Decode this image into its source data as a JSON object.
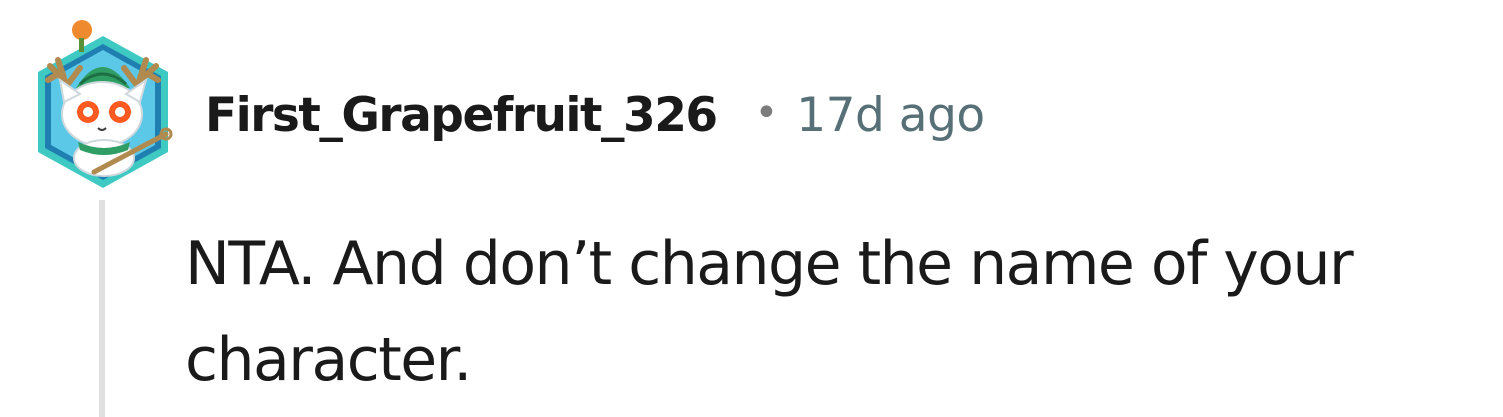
{
  "comment": {
    "author": "First_Grapefruit_326",
    "separator": "•",
    "timestamp": "17d ago",
    "body": "NTA. And don’t change the name of your character."
  },
  "avatar": {
    "icon": "snoo-avatar-deer-antlers-icon",
    "frame_color": "#3ec9c2",
    "frame_inner_color": "#1f7fb0",
    "antler_color": "#b08a4e",
    "ornament_color": "#f08a2e",
    "hat_color": "#2f9e64"
  },
  "thread": {
    "line_color": "#e0e0e0"
  }
}
